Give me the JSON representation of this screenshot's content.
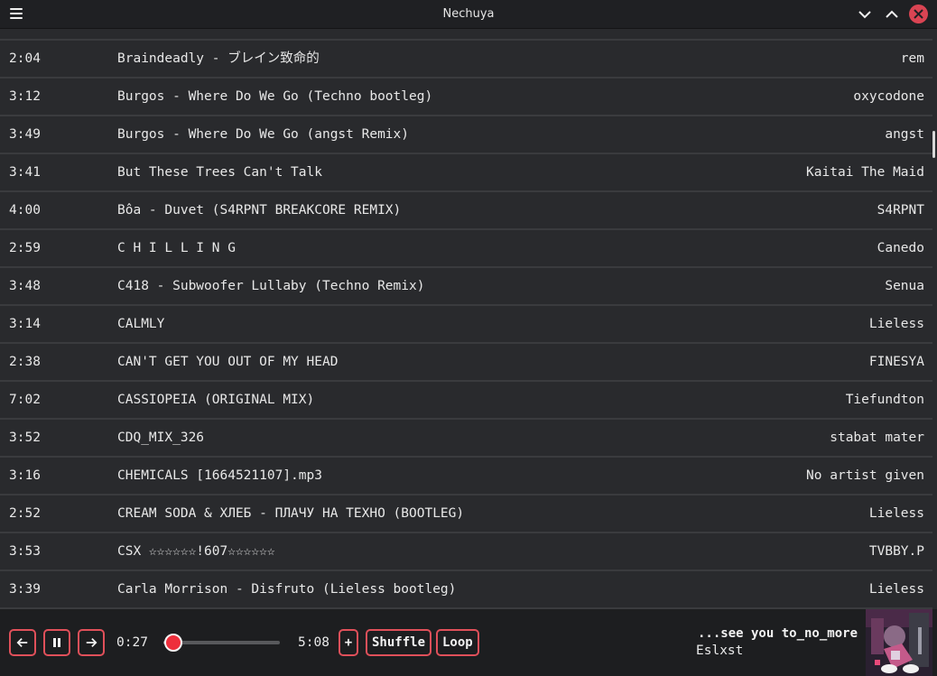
{
  "window": {
    "title": "Nechuya"
  },
  "tracks": [
    {
      "duration": "2:04",
      "title": "Braindeadly - ブレイン致命的",
      "artist": "rem"
    },
    {
      "duration": "3:12",
      "title": "Burgos - Where Do We Go (Techno bootleg)",
      "artist": "oxycodone"
    },
    {
      "duration": "3:49",
      "title": "Burgos - Where Do We Go (angst Remix)",
      "artist": "angst"
    },
    {
      "duration": "3:41",
      "title": "But These Trees Can't Talk",
      "artist": "Kaitai The Maid"
    },
    {
      "duration": "4:00",
      "title": "Bôa - Duvet (S4RPNT BREAKCORE REMIX)",
      "artist": "S4RPNT"
    },
    {
      "duration": "2:59",
      "title": "C H I L L I N G",
      "artist": "Canedo"
    },
    {
      "duration": "3:48",
      "title": "C418 - Subwoofer Lullaby (Techno Remix)",
      "artist": "Senua"
    },
    {
      "duration": "3:14",
      "title": "CALMLY",
      "artist": "Lieless"
    },
    {
      "duration": "2:38",
      "title": "CAN'T GET YOU OUT OF MY HEAD",
      "artist": "FINESYA"
    },
    {
      "duration": "7:02",
      "title": "CASSIOPEIA (ORIGINAL MIX)",
      "artist": "Tiefundton"
    },
    {
      "duration": "3:52",
      "title": "CDQ_MIX_326",
      "artist": "stabat mater"
    },
    {
      "duration": "3:16",
      "title": "CHEMICALS [1664521107].mp3",
      "artist": "No artist given"
    },
    {
      "duration": "2:52",
      "title": "CREAM SODA & ХЛЕБ - ПЛАЧУ НА ТЕХНО (BOOTLEG)",
      "artist": "Lieless"
    },
    {
      "duration": "3:53",
      "title": "CSX ☆☆☆☆☆☆!607☆☆☆☆☆☆",
      "artist": "TVBBY.P"
    },
    {
      "duration": "3:39",
      "title": "Carla Morrison - Disfruto (Lieless bootleg)",
      "artist": "Lieless"
    }
  ],
  "player": {
    "elapsed": "0:27",
    "total": "5:08",
    "progress": 0.088,
    "add_label": "+",
    "shuffle_label": "Shuffle",
    "loop_label": "Loop",
    "now_playing": {
      "title": "...see you to_no_more",
      "artist": "Eslxst"
    }
  },
  "colors": {
    "accent": "#e0505a",
    "close": "#da4453",
    "knob": "#ee2f3c",
    "background": "#292a2d"
  },
  "icons": [
    "menu-icon",
    "minimize-icon",
    "maximize-icon",
    "close-icon",
    "previous-icon",
    "pause-icon",
    "next-icon"
  ]
}
